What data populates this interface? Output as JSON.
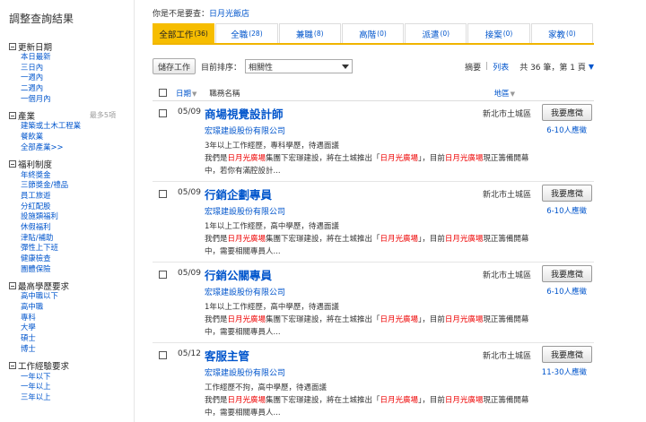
{
  "sidebar": {
    "title": "調整查詢結果",
    "groups": [
      {
        "label": "更新日期",
        "note": "",
        "items": [
          "本日最新",
          "三日內",
          "一週內",
          "二週內",
          "一個月內"
        ]
      },
      {
        "label": "產業",
        "note": "最多5項",
        "items": [
          "建築或土木工程業",
          "餐飲業",
          "全部產業>>"
        ]
      },
      {
        "label": "福利制度",
        "note": "",
        "items": [
          "年終獎金",
          "三節獎金/禮品",
          "員工旅遊",
          "分紅配股",
          "設施類福利",
          "休假福利",
          "津貼/補助",
          "彈性上下班",
          "健康檢查",
          "團體保險"
        ]
      },
      {
        "label": "最高學歷要求",
        "note": "",
        "items": [
          "高中職以下",
          "高中職",
          "專科",
          "大學",
          "碩士",
          "博士"
        ]
      },
      {
        "label": "工作經驗要求",
        "note": "",
        "items": [
          "一年以下",
          "一年以上",
          "三年以上"
        ]
      }
    ]
  },
  "suggest": {
    "prefix": "你是不是要查：",
    "term": "日月光飯店"
  },
  "tabs": [
    {
      "label": "全部工作",
      "count": "(36)",
      "active": true
    },
    {
      "label": "全職",
      "count": "(28)"
    },
    {
      "label": "兼職",
      "count": "(8)"
    },
    {
      "label": "高階",
      "count": "(0)"
    },
    {
      "label": "派遣",
      "count": "(0)"
    },
    {
      "label": "接案",
      "count": "(0)"
    },
    {
      "label": "家教",
      "count": "(0)"
    }
  ],
  "toolbar": {
    "save_label": "儲存工作",
    "sort_label": "目前排序：",
    "sort_value": "相關性",
    "summary_label": "摘要",
    "list_label": "列表",
    "page_info": "共 36 筆，第 1 頁"
  },
  "list_head": {
    "date": "日期",
    "job": "職務名稱",
    "area": "地區"
  },
  "jobs": [
    {
      "date": "05/09",
      "title": "商場視覺設計師",
      "company": "宏璟建設股份有限公司",
      "req": "3年以上工作經歷，專科學歷，待遇面議",
      "desc": {
        "a": "我們是",
        "h1": "日月光廣場",
        "b": "集團下宏璟建設，將在土城推出「",
        "h2": "日月光廣場",
        "c": "」，目前",
        "h3": "日月光廣場",
        "d": "現正籌備開幕中，若你有滿腔設計..."
      },
      "area": "新北市土城區",
      "apply": "我要應徵",
      "applicants": "6-10人應徵"
    },
    {
      "date": "05/09",
      "title": "行銷企劃專員",
      "company": "宏璟建設股份有限公司",
      "req": "1年以上工作經歷，高中學歷，待遇面議",
      "desc": {
        "a": "我們是",
        "h1": "日月光廣場",
        "b": "集團下宏璟建設，將在土城推出「",
        "h2": "日月光廣場",
        "c": "」，目前",
        "h3": "日月光廣場",
        "d": "現正籌備開幕中，需要相關專員人..."
      },
      "area": "新北市土城區",
      "apply": "我要應徵",
      "applicants": "6-10人應徵"
    },
    {
      "date": "05/09",
      "title": "行銷公關專員",
      "company": "宏璟建設股份有限公司",
      "req": "1年以上工作經歷，高中學歷，待遇面議",
      "desc": {
        "a": "我們是",
        "h1": "日月光廣場",
        "b": "集團下宏璟建設，將在土城推出「",
        "h2": "日月光廣場",
        "c": "」，目前",
        "h3": "日月光廣場",
        "d": "現正籌備開幕中，需要相關專員人..."
      },
      "area": "新北市土城區",
      "apply": "我要應徵",
      "applicants": "6-10人應徵"
    },
    {
      "date": "05/12",
      "title": "客服主管",
      "company": "宏璟建設股份有限公司",
      "req": "工作經歷不拘，高中學歷，待遇面議",
      "desc": {
        "a": "我們是",
        "h1": "日月光廣場",
        "b": "集團下宏璟建設，將在土城推出「",
        "h2": "日月光廣場",
        "c": "」，目前",
        "h3": "日月光廣場",
        "d": "現正籌備開幕中，需要相關專員人..."
      },
      "area": "新北市土城區",
      "apply": "我要應徵",
      "applicants": "11-30人應徵"
    }
  ]
}
